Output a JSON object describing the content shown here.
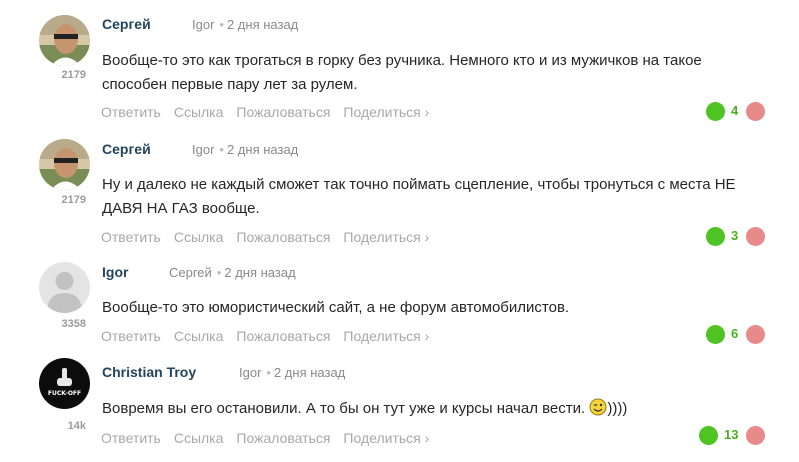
{
  "comments": [
    {
      "author": "Сергей",
      "reply_to": "Igor",
      "time": "2 дня назад",
      "rating": "2179",
      "avatar": "man-with-sunglasses",
      "text": "Вообще-то это как трогаться в горку без ручника. Немного кто и из мужичков на такое способен первые пару лет за рулем.",
      "votes": "4"
    },
    {
      "author": "Сергей",
      "reply_to": "Igor",
      "time": "2 дня назад",
      "rating": "2179",
      "avatar": "man-with-sunglasses",
      "text": "Ну и далеко не каждый сможет так точно поймать сцепление, чтобы тронуться с места НЕ ДАВЯ НА ГАЗ вообще.",
      "votes": "3"
    },
    {
      "author": "Igor",
      "reply_to": "Сергей",
      "time": "2 дня назад",
      "rating": "3358",
      "avatar": "default-user-silhouette",
      "text": "Вообще-то это юмористический сайт, а не форум автомобилистов.",
      "votes": "6"
    },
    {
      "author": "Christian Troy",
      "reply_to": "Igor",
      "time": "2 дня назад",
      "rating": "14k",
      "avatar": "black-fuck-off-logo",
      "avatar_text": "FUCK-OFF",
      "text": "Вовремя вы его остановили. А то бы он тут уже и курсы начал вести.",
      "text_suffix": "))))",
      "votes": "13"
    }
  ],
  "actions": {
    "reply": "Ответить",
    "link": "Ссылка",
    "report": "Пожаловаться",
    "share": "Поделиться ›"
  },
  "colors": {
    "author": "#24445c",
    "vote_up": "#4ec321",
    "vote_down": "#e68a8a",
    "vote_count": "#4ab01c",
    "action_text": "#a8a8a8"
  },
  "icons": {
    "vote_up": "green-circle",
    "vote_down": "red-circle",
    "smiley": "winking-smiley"
  }
}
